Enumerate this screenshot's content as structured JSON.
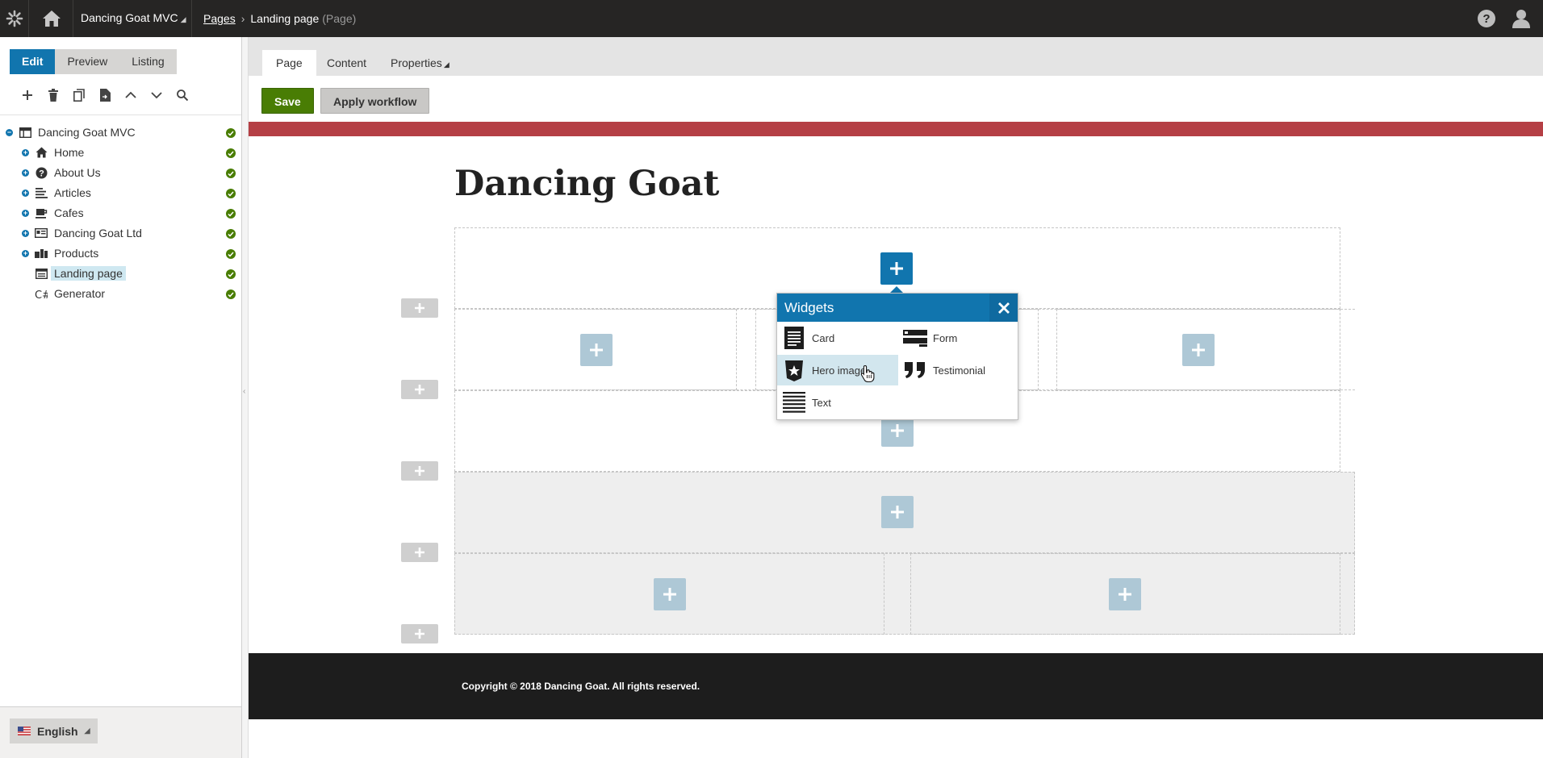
{
  "topbar": {
    "site_name": "Dancing Goat MVC",
    "breadcrumb_link": "Pages",
    "breadcrumb_current": "Landing page",
    "breadcrumb_type": "(Page)"
  },
  "modes": [
    "Edit",
    "Preview",
    "Listing"
  ],
  "tree": [
    {
      "label": "Dancing Goat MVC",
      "icon": "site-icon"
    },
    {
      "label": "Home",
      "icon": "home-icon"
    },
    {
      "label": "About Us",
      "icon": "question-icon"
    },
    {
      "label": "Articles",
      "icon": "list-icon"
    },
    {
      "label": "Cafes",
      "icon": "coffee-cup-icon"
    },
    {
      "label": "Dancing Goat Ltd",
      "icon": "id-card-icon"
    },
    {
      "label": "Products",
      "icon": "products-icon"
    },
    {
      "label": "Landing page",
      "icon": "landing-page-icon"
    },
    {
      "label": "Generator",
      "icon": "csharp-icon"
    }
  ],
  "language": "English",
  "tabs": {
    "page": "Page",
    "content": "Content",
    "properties": "Properties"
  },
  "actions": {
    "save": "Save",
    "apply_workflow": "Apply workflow"
  },
  "page": {
    "title": "Dancing Goat",
    "footer": "Copyright © 2018 Dancing Goat. All rights reserved."
  },
  "widgets_popup": {
    "title": "Widgets",
    "items": [
      "Card",
      "Form",
      "Hero image",
      "Testimonial",
      "Text"
    ]
  },
  "colors": {
    "topbar": "#262524",
    "accent_blue": "#1175ae",
    "save_green": "#497d04",
    "header_band_red": "#b53f45",
    "footer": "#1d1d1d"
  }
}
